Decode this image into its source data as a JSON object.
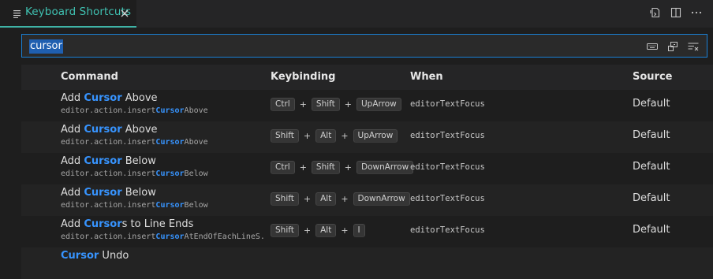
{
  "tab": {
    "label": "Keyboard Shortcuts"
  },
  "search": {
    "value": "cursor"
  },
  "headers": {
    "command": "Command",
    "keybinding": "Keybinding",
    "when": "When",
    "source": "Source"
  },
  "rows": [
    {
      "title": [
        "Add ",
        "Cursor",
        " Above"
      ],
      "id": [
        "editor.action.insert",
        "Cursor",
        "Above"
      ],
      "keys": [
        "Ctrl",
        "Shift",
        "UpArrow"
      ],
      "when": "editorTextFocus",
      "source": "Default"
    },
    {
      "title": [
        "Add ",
        "Cursor",
        " Above"
      ],
      "id": [
        "editor.action.insert",
        "Cursor",
        "Above"
      ],
      "keys": [
        "Shift",
        "Alt",
        "UpArrow"
      ],
      "when": "editorTextFocus",
      "source": "Default"
    },
    {
      "title": [
        "Add ",
        "Cursor",
        " Below"
      ],
      "id": [
        "editor.action.insert",
        "Cursor",
        "Below"
      ],
      "keys": [
        "Ctrl",
        "Shift",
        "DownArrow"
      ],
      "when": "editorTextFocus",
      "source": "Default"
    },
    {
      "title": [
        "Add ",
        "Cursor",
        " Below"
      ],
      "id": [
        "editor.action.insert",
        "Cursor",
        "Below"
      ],
      "keys": [
        "Shift",
        "Alt",
        "DownArrow"
      ],
      "when": "editorTextFocus",
      "source": "Default"
    },
    {
      "title": [
        "Add ",
        "Cursor",
        "s to Line Ends"
      ],
      "id": [
        "editor.action.insert",
        "Cursor",
        "AtEndOfEachLineS..."
      ],
      "keys": [
        "Shift",
        "Alt",
        "I"
      ],
      "when": "editorTextFocus",
      "source": "Default"
    },
    {
      "title": [
        "",
        "Cursor",
        " Undo"
      ],
      "id": [
        "",
        "",
        ""
      ],
      "keys": [],
      "when": "",
      "source": ""
    }
  ]
}
